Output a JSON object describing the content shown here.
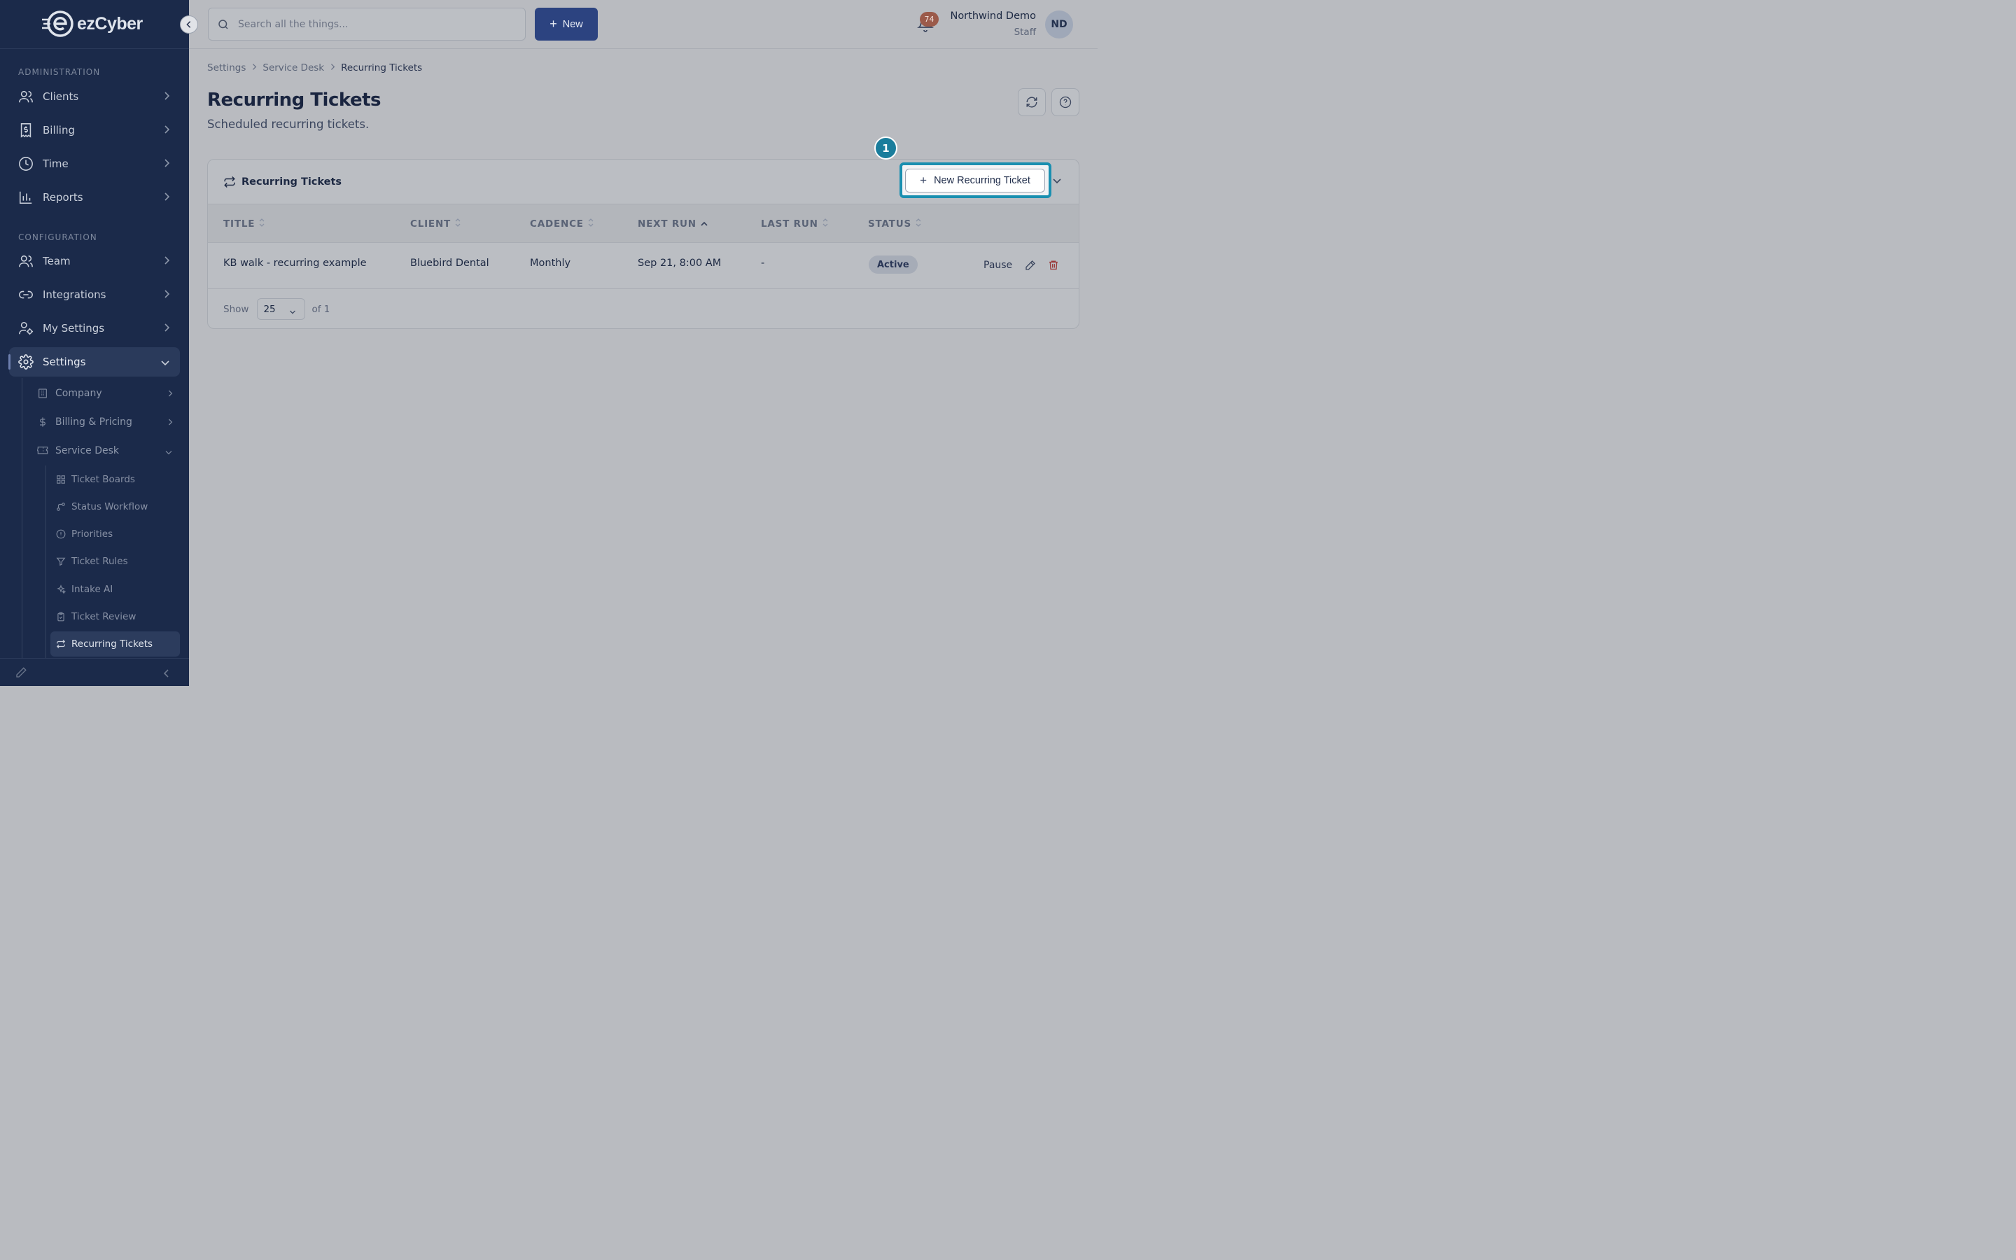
{
  "brand": {
    "name": "ezCyber"
  },
  "topbar": {
    "search_placeholder": "Search all the things...",
    "new_label": "New",
    "notification_count": "74",
    "user_name": "Northwind Demo",
    "user_role": "Staff",
    "avatar_initials": "ND"
  },
  "sidebar": {
    "section_admin": "ADMINISTRATION",
    "section_config": "CONFIGURATION",
    "items": {
      "clients": "Clients",
      "billing": "Billing",
      "time": "Time",
      "reports": "Reports",
      "team": "Team",
      "integrations": "Integrations",
      "my_settings": "My Settings",
      "settings": "Settings"
    },
    "settings_sub": {
      "company": "Company",
      "billing_pricing": "Billing & Pricing",
      "service_desk": "Service Desk"
    },
    "service_desk_sub": {
      "ticket_boards": "Ticket Boards",
      "status_workflow": "Status Workflow",
      "priorities": "Priorities",
      "ticket_rules": "Ticket Rules",
      "intake_ai": "Intake AI",
      "ticket_review": "Ticket Review",
      "recurring_tickets": "Recurring Tickets"
    }
  },
  "breadcrumb": [
    "Settings",
    "Service Desk",
    "Recurring Tickets"
  ],
  "page": {
    "title": "Recurring Tickets",
    "subtitle": "Scheduled recurring tickets."
  },
  "card": {
    "title": "Recurring Tickets",
    "new_button": "New Recurring Ticket",
    "step_marker": "1",
    "columns": {
      "title": "TITLE",
      "client": "CLIENT",
      "cadence": "CADENCE",
      "next_run": "NEXT RUN",
      "last_run": "LAST RUN",
      "status": "STATUS"
    },
    "rows": [
      {
        "title": "KB walk - recurring example",
        "client": "Bluebird Dental",
        "cadence": "Monthly",
        "next_run": "Sep 21, 8:00 AM",
        "last_run": "-",
        "status": "Active",
        "action_pause": "Pause"
      }
    ],
    "footer": {
      "show_label": "Show",
      "page_size": "25",
      "of_label": "of 1"
    }
  },
  "colors": {
    "sidebar_bg": "#1b2a4a",
    "primary_button": "#2c4380",
    "highlight": "#1a8fb0",
    "delete": "#9a3a3a"
  }
}
